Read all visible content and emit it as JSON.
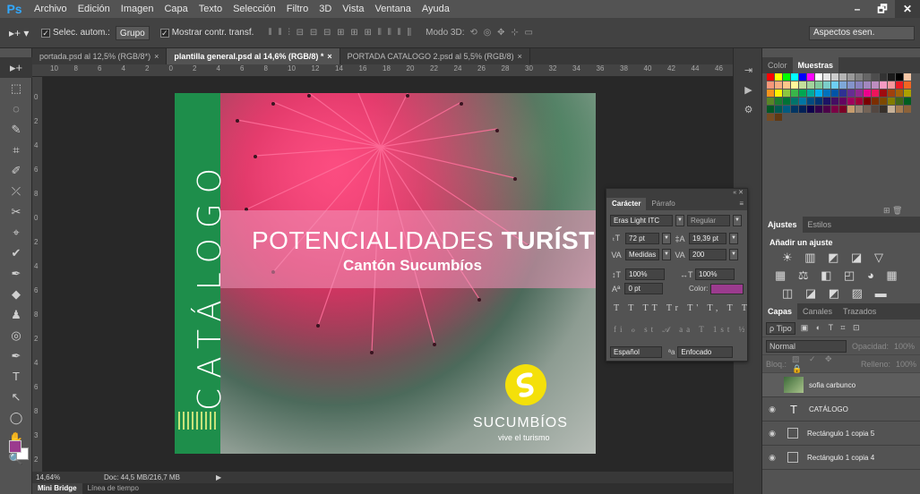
{
  "app": {
    "logo": "Ps"
  },
  "menu": [
    "Archivo",
    "Edición",
    "Imagen",
    "Capa",
    "Texto",
    "Selección",
    "Filtro",
    "3D",
    "Vista",
    "Ventana",
    "Ayuda"
  ],
  "window_controls": {
    "minimize": "–",
    "maximize": "🗗",
    "close": "✕"
  },
  "options_bar": {
    "tool_icon": "▸+ ▾",
    "auto_select_label": "Selec. autom.:",
    "auto_select_value": "Grupo",
    "transform_controls_label": "Mostrar contr. transf.",
    "align_icons": "⫴ ⫴ ⫶  ⊟ ⊟ ⊟  ⊞ ⊞ ⊞  ⫴ ⫴ ⫴  ⫼",
    "mode_3d_label": "Modo 3D:",
    "mode_3d_icons": "⟲ ◎ ✥ ⊹ ▭",
    "workspace": "Aspectos esen."
  },
  "tools": [
    "▸+",
    "⬚",
    "◌",
    "✎",
    "⌗",
    "✐",
    "⤫",
    "✂",
    "⌖",
    "✔",
    "✒",
    "◆",
    "♟",
    "◎",
    "●",
    "🔍",
    "✒",
    "T",
    "↖",
    "◯",
    "✋",
    "🔍",
    "⇄"
  ],
  "tabs": [
    {
      "label": "portada.psd al 12,5% (RGB/8*)",
      "close": "×"
    },
    {
      "label": "plantilla general.psd al 14,6% (RGB/8) *",
      "close": "×"
    },
    {
      "label": "PORTADA CATALOGO 2.psd al 5,5% (RGB/8)",
      "close": "×"
    }
  ],
  "ruler_top_labels": [
    "10",
    "8",
    "6",
    "4",
    "2",
    "0",
    "2",
    "4",
    "6",
    "8",
    "10",
    "12",
    "14",
    "16",
    "18",
    "20",
    "22",
    "24",
    "26",
    "28",
    "30",
    "32",
    "34",
    "36",
    "38",
    "40",
    "42",
    "44",
    "46"
  ],
  "ruler_left_labels": [
    "0",
    "2",
    "4",
    "6",
    "8",
    "0",
    "2",
    "4",
    "6",
    "8",
    "2",
    "4",
    "6",
    "8",
    "3",
    "2"
  ],
  "document": {
    "catalog_word": "CATÁLOGO",
    "title_part1": "POTENCIALIDADES",
    "title_part2": "TURÍSTICAS",
    "subtitle": "Cantón Sucumbíos",
    "brand_name": "SUCUMBÍOS",
    "brand_tagline": "vive el turismo",
    "colors": {
      "green": "#1e8e4b",
      "pink": "#e43a6e",
      "yellow": "#f4e00a"
    }
  },
  "status": {
    "zoom": "14,64%",
    "doc": "Doc: 44,5 MB/216,7 MB",
    "arrow": "▶"
  },
  "bottom_tabs": [
    "Mini Bridge",
    "Línea de tiempo"
  ],
  "icon_strip": [
    "⇥",
    "▶",
    "⚙"
  ],
  "swatches_panel": {
    "tabs": [
      "Color",
      "Muestras"
    ],
    "colors": [
      "#ff0000",
      "#ffff00",
      "#00ff00",
      "#00ffff",
      "#0000ff",
      "#ff00ff",
      "#ffffff",
      "#e6e6e6",
      "#cccccc",
      "#b3b3b3",
      "#999999",
      "#808080",
      "#666666",
      "#4d4d4d",
      "#333333",
      "#1a1a1a",
      "#000000",
      "#f5c6a5",
      "#f7977a",
      "#f9ad81",
      "#fdc68a",
      "#fff79a",
      "#c4df9b",
      "#a2d39c",
      "#82ca9d",
      "#7bcdc8",
      "#6ecff6",
      "#7ea7d8",
      "#8493ca",
      "#8882be",
      "#a187be",
      "#bc8dbf",
      "#f49ac2",
      "#f6989d",
      "#ed1c24",
      "#f26522",
      "#f7941d",
      "#fff200",
      "#8dc63f",
      "#39b54a",
      "#00a651",
      "#00a99d",
      "#00aeef",
      "#0072bc",
      "#0054a6",
      "#2e3192",
      "#662d91",
      "#92278f",
      "#ec008c",
      "#ed145b",
      "#9e0b0f",
      "#a0410d",
      "#a36209",
      "#aba000",
      "#598527",
      "#1a7b30",
      "#007236",
      "#00746b",
      "#0076a3",
      "#004b80",
      "#003471",
      "#1b1464",
      "#440e62",
      "#630460",
      "#9e005d",
      "#9e0039",
      "#790000",
      "#7b2e00",
      "#7d4900",
      "#827b00",
      "#406618",
      "#005e20",
      "#005826",
      "#005952",
      "#005b7f",
      "#003663",
      "#002157",
      "#0d004c",
      "#32004b",
      "#4b0049",
      "#7b0046",
      "#7a0026",
      "#c69c6d",
      "#998675",
      "#736357",
      "#534741",
      "#37302a",
      "#c7b299",
      "#a67c52",
      "#8c6239",
      "#754c24",
      "#603913"
    ],
    "icons": "⊞ 🗑"
  },
  "adjustments_panel": {
    "tabs": [
      "Ajustes",
      "Estilos"
    ],
    "title": "Añadir un ajuste",
    "row1": "☀ ▥ ◩ ◪ ▽",
    "row2": "▦ ⚖ ◧ ◰ ◕ ▦",
    "row3": "◫ ◪ ◩ ▨ ▬"
  },
  "layers_panel": {
    "tabs": [
      "Capas",
      "Canales",
      "Trazados"
    ],
    "kind_filter": "ρ Tipo",
    "filter_icons": "▣ ◐ T ⌗ ⊡",
    "blend_mode": "Normal",
    "opacity_label": "Opacidad:",
    "opacity_value": "100%",
    "lock_label": "Bloq.:",
    "lock_icons": "▨ ✓ ✥ 🔒",
    "fill_label": "Relleno:",
    "fill_value": "100%",
    "layers": [
      {
        "name": "sofia carbunco",
        "eye": "",
        "thumb": ""
      },
      {
        "name": "CATÁLOGO",
        "eye": "◉",
        "thumb": "T"
      },
      {
        "name": "Rectángulo 1 copia 5",
        "eye": "◉",
        "thumb": ""
      },
      {
        "name": "Rectángulo 1 copia 4",
        "eye": "◉",
        "thumb": ""
      }
    ]
  },
  "character_panel": {
    "collapse": "«  ✕",
    "tabs": [
      "Carácter",
      "Párrafo"
    ],
    "menu_icon": "≡",
    "font_family": "Eras Light ITC",
    "font_style": "Regular",
    "size": "72 pt",
    "leading": "19,39 pt",
    "kerning": "Medidas",
    "tracking": "200",
    "vertical_scale": "100%",
    "horizontal_scale": "100%",
    "baseline_shift": "0 pt",
    "color_label": "Color:",
    "color": "#9b3b8e",
    "style_buttons": "T T TT Tr T' T, T T",
    "opentype_buttons": "fi ℴ st 𝒜 aa T 1st ½",
    "language": "Español",
    "aa_label": "ªa",
    "antialias": "Enfocado"
  }
}
